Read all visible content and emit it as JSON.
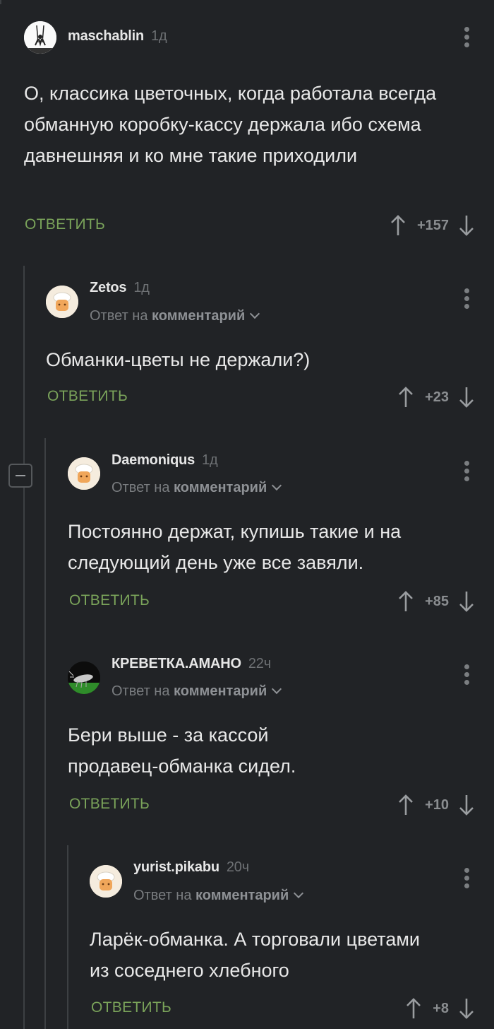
{
  "comments": [
    {
      "author": "maschablin",
      "time": "1д",
      "text": "О, классика цветочных, когда работала всегда обманную коробку-кассу держала ибо схема давнешняя и ко мне такие приходили",
      "reply_label": "ОТВЕТИТЬ",
      "rating": "+157",
      "avatar_icon": "gymnast-avatar-icon"
    },
    {
      "author": "Zetos",
      "time": "1д",
      "reply_prefix": "Ответ на",
      "reply_target": "комментарий",
      "text": "Обманки-цветы не держали?)",
      "reply_label": "ОТВЕТИТЬ",
      "rating": "+23",
      "avatar_icon": "chef-default-avatar-icon"
    },
    {
      "author": "Daemoniqus",
      "time": "1д",
      "reply_prefix": "Ответ на",
      "reply_target": "комментарий",
      "text": "Постоянно держат, купишь такие и на следующий день уже все завяли.",
      "reply_label": "ОТВЕТИТЬ",
      "rating": "+85",
      "avatar_icon": "chef-default-avatar-icon"
    },
    {
      "author": "КРЕВЕТКА.АМАНО",
      "time": "22ч",
      "reply_prefix": "Ответ на",
      "reply_target": "комментарий",
      "text": "Бери выше - за кассой продавец-обманка сидел.",
      "reply_label": "ОТВЕТИТЬ",
      "rating": "+10",
      "avatar_icon": "shrimp-avatar-icon"
    },
    {
      "author": "yurist.pikabu",
      "time": "20ч",
      "reply_prefix": "Ответ на",
      "reply_target": "комментарий",
      "text": "Ларёк-обманка. А торговали цветами из соседнего хлебного",
      "reply_label": "ОТВЕТИТЬ",
      "rating": "+8",
      "avatar_icon": "chef-default-avatar-icon"
    }
  ],
  "colors": {
    "background": "#212326",
    "reply_button": "#7aa35a",
    "thread_line": "#3d4043"
  }
}
